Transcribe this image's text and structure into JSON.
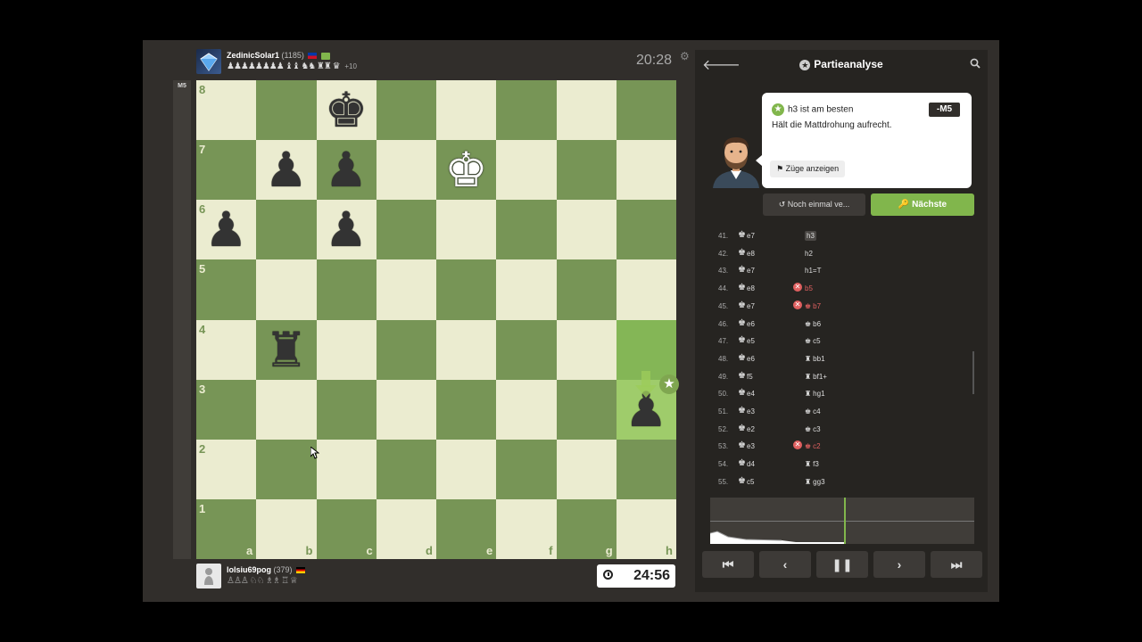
{
  "top_player": {
    "name": "ZedinicSolar1",
    "rating": "(1185)",
    "captured": "♟♟♟♟♟♟♟♟ ♝♝ ♞♞ ♜♜ ♛",
    "advantage": "+10",
    "clock": "20:28"
  },
  "bottom_player": {
    "name": "lolsiu69pog",
    "rating": "(379)",
    "captured": "♙♙♙ ♘♘ ♗♗ ♖ ♕",
    "clock": "24:56"
  },
  "eval_bar_label": "M5",
  "board": {
    "ranks": [
      "8",
      "7",
      "6",
      "5",
      "4",
      "3",
      "2",
      "1"
    ],
    "files": [
      "a",
      "b",
      "c",
      "d",
      "e",
      "f",
      "g",
      "h"
    ],
    "pieces": [
      {
        "square": "c8",
        "glyph": "♚",
        "color": "black",
        "name": "black-king"
      },
      {
        "square": "b7",
        "glyph": "♟",
        "color": "black",
        "name": "black-pawn-b7"
      },
      {
        "square": "c7",
        "glyph": "♟",
        "color": "black",
        "name": "black-pawn-c7"
      },
      {
        "square": "e7",
        "glyph": "♚",
        "color": "white",
        "name": "white-king"
      },
      {
        "square": "a6",
        "glyph": "♟",
        "color": "black",
        "name": "black-pawn-a6"
      },
      {
        "square": "c6",
        "glyph": "♟",
        "color": "black",
        "name": "black-pawn-c6"
      },
      {
        "square": "b4",
        "glyph": "♜",
        "color": "black",
        "name": "black-rook-b4"
      },
      {
        "square": "h3",
        "glyph": "♟",
        "color": "black",
        "name": "black-pawn-h3"
      }
    ],
    "highlights": [
      "h4",
      "h3"
    ],
    "best_move_square": "h3"
  },
  "panel": {
    "title": "Partieanalyse",
    "best_text": "h3 ist am besten",
    "eval": "-M5",
    "description": "Hält die Mattdrohung aufrecht.",
    "show_moves": "Züge anzeigen",
    "retry": "Noch einmal ve...",
    "next": "Nächste"
  },
  "moves": [
    {
      "n": "41.",
      "w": "e7",
      "b": "h3",
      "bp": "",
      "mark": false,
      "sel": true
    },
    {
      "n": "42.",
      "w": "e8",
      "b": "h2",
      "bp": "",
      "mark": false,
      "sel": false
    },
    {
      "n": "43.",
      "w": "e7",
      "b": "h1=T",
      "bp": "",
      "mark": false,
      "sel": false
    },
    {
      "n": "44.",
      "w": "e8",
      "b": "b5",
      "bp": "",
      "mark": true,
      "sel": false
    },
    {
      "n": "45.",
      "w": "e7",
      "b": "b7",
      "bp": "♚",
      "mark": true,
      "sel": false
    },
    {
      "n": "46.",
      "w": "e6",
      "b": "b6",
      "bp": "♚",
      "mark": false,
      "sel": false
    },
    {
      "n": "47.",
      "w": "e5",
      "b": "c5",
      "bp": "♚",
      "mark": false,
      "sel": false
    },
    {
      "n": "48.",
      "w": "e6",
      "b": "bb1",
      "bp": "♜",
      "mark": false,
      "sel": false
    },
    {
      "n": "49.",
      "w": "f5",
      "b": "bf1+",
      "bp": "♜",
      "mark": false,
      "sel": false
    },
    {
      "n": "50.",
      "w": "e4",
      "b": "hg1",
      "bp": "♜",
      "mark": false,
      "sel": false
    },
    {
      "n": "51.",
      "w": "e3",
      "b": "c4",
      "bp": "♚",
      "mark": false,
      "sel": false
    },
    {
      "n": "52.",
      "w": "e2",
      "b": "c3",
      "bp": "♚",
      "mark": false,
      "sel": false
    },
    {
      "n": "53.",
      "w": "e3",
      "b": "c2",
      "bp": "♚",
      "mark": true,
      "sel": false
    },
    {
      "n": "54.",
      "w": "d4",
      "b": "f3",
      "bp": "♜",
      "mark": false,
      "sel": false
    },
    {
      "n": "55.",
      "w": "c5",
      "b": "gg3",
      "bp": "♜",
      "mark": false,
      "sel": false
    }
  ],
  "nav": {
    "first": "⏮",
    "prev": "‹",
    "pause": "❚❚",
    "next": "›",
    "last": "⏭"
  },
  "colors": {
    "light_square": "#ebecd0",
    "dark_square": "#779556",
    "accent_green": "#81b64c",
    "mistake_red": "#e06060",
    "panel_bg": "#262421"
  }
}
